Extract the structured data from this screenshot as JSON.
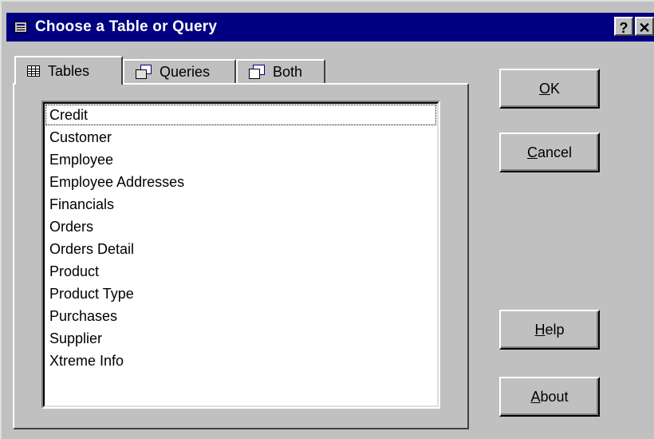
{
  "window": {
    "title": "Choose a Table or Query",
    "help_glyph": "?",
    "close_glyph": "✕"
  },
  "tabs": [
    {
      "label": "Tables",
      "icon": "table-icon",
      "active": true
    },
    {
      "label": "Queries",
      "icon": "query-icon",
      "active": false
    },
    {
      "label": "Both",
      "icon": "both-icon",
      "active": false
    }
  ],
  "list": {
    "items": [
      "Credit",
      "Customer",
      "Employee",
      "Employee Addresses",
      "Financials",
      "Orders",
      "Orders Detail",
      "Product",
      "Product Type",
      "Purchases",
      "Supplier",
      "Xtreme Info"
    ],
    "focused_index": 0
  },
  "buttons": {
    "ok": {
      "mnemonic": "O",
      "rest": "K"
    },
    "cancel": {
      "mnemonic": "C",
      "rest": "ancel"
    },
    "help": {
      "mnemonic": "H",
      "rest": "elp"
    },
    "about": {
      "mnemonic": "A",
      "rest": "bout"
    }
  }
}
